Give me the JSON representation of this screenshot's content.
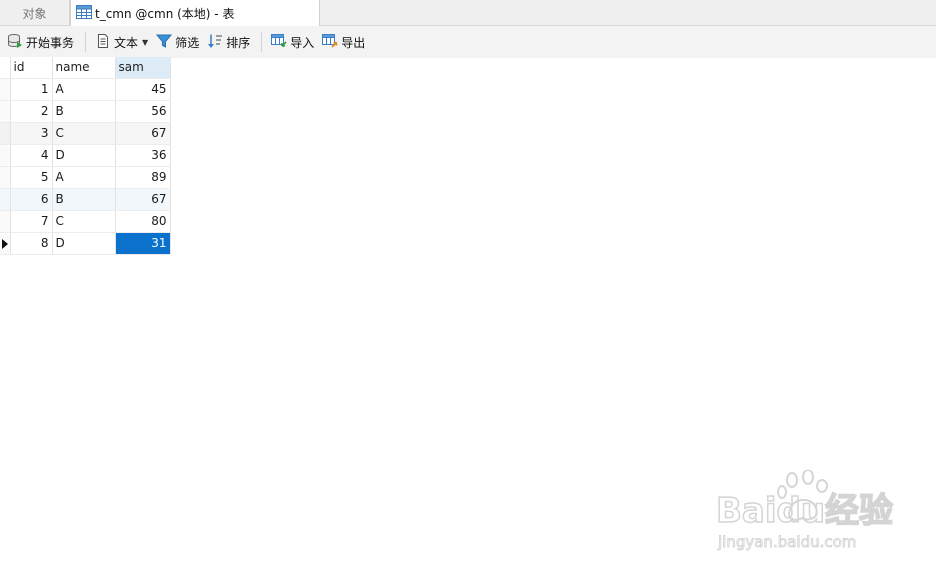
{
  "tabs": {
    "objects_label": "对象",
    "table_tab_label": "t_cmn @cmn (本地) - 表"
  },
  "toolbar": {
    "begin_transaction": "开始事务",
    "text": "文本",
    "filter": "筛选",
    "sort": "排序",
    "import": "导入",
    "export": "导出"
  },
  "grid": {
    "columns": [
      "id",
      "name",
      "sam"
    ],
    "rows": [
      [
        "1",
        "A",
        "45"
      ],
      [
        "2",
        "B",
        "56"
      ],
      [
        "3",
        "C",
        "67"
      ],
      [
        "4",
        "D",
        "36"
      ],
      [
        "5",
        "A",
        "89"
      ],
      [
        "6",
        "B",
        "67"
      ],
      [
        "7",
        "C",
        "80"
      ],
      [
        "8",
        "D",
        "31"
      ]
    ],
    "current_row": 8,
    "selected_column": "sam"
  },
  "watermark": {
    "brand": "Baidu经验",
    "url": "jingyan.baidu.com"
  },
  "colors": {
    "selection": "#0a72cc",
    "selected_header": "#ddebf7"
  }
}
